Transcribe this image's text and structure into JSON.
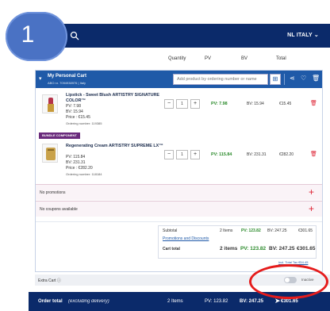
{
  "badge": {
    "number": "1"
  },
  "header": {
    "region": "NL ITALY ⌄"
  },
  "columns": {
    "quantity": "Quantity",
    "pv": "PV",
    "bv": "BV",
    "total": "Total"
  },
  "cart": {
    "title": "My Personal Cart",
    "subtitle": "ABO nr. 7094938976 | Italy",
    "add_placeholder": "Add product by ordering number or name",
    "items": [
      {
        "name": "Lipstick - Sweet Blush ARTISTRY SIGNATURE COLOR™",
        "pv": "PV: 7.98",
        "bv": "BV: 15.94",
        "price": "Price : €15.45",
        "ordering": "Ordering number: 119385",
        "qty": "1",
        "pv_col": "PV: 7.98",
        "bv_col": "BV: 15.94",
        "total": "€15.45"
      },
      {
        "badge": "BUNDLE COMPONENT",
        "name": "Regenerating Cream ARTISTRY SUPREME LX™",
        "pv": "PV: 115.84",
        "bv": "BV: 231.31",
        "price": "Price : €282.20",
        "ordering": "Ordering number: 118184",
        "qty": "1",
        "pv_col": "PV: 115.84",
        "bv_col": "BV: 231.31",
        "total": "€282.20"
      }
    ],
    "no_promotions": "No promotions",
    "no_coupons": "No coupons available",
    "summary": {
      "subtotal_label": "Subtotal",
      "subtotal_items": "2 Items",
      "subtotal_pv": "PV: 123.82",
      "subtotal_bv": "BV: 247.25",
      "subtotal_total": "€301.65",
      "promotions_link": "Promotions and Discounts",
      "cart_total_label": "Cart total",
      "cart_total_items": "2 items",
      "cart_total_pv": "PV: 123.82",
      "cart_total_bv": "BV: 247.25",
      "cart_total_total": "€301.65",
      "vat_note": "Incl. Total Tax €54.45"
    }
  },
  "extra_cart": {
    "label": "Extra Cart ⓘ",
    "toggle_label": "Inactive"
  },
  "footer": {
    "label": "Order total",
    "note": "(excluding delivery)",
    "items": "2 Items",
    "pv": "PV: 123.82",
    "bv": "BV: 247.25",
    "total": "€301.65"
  }
}
